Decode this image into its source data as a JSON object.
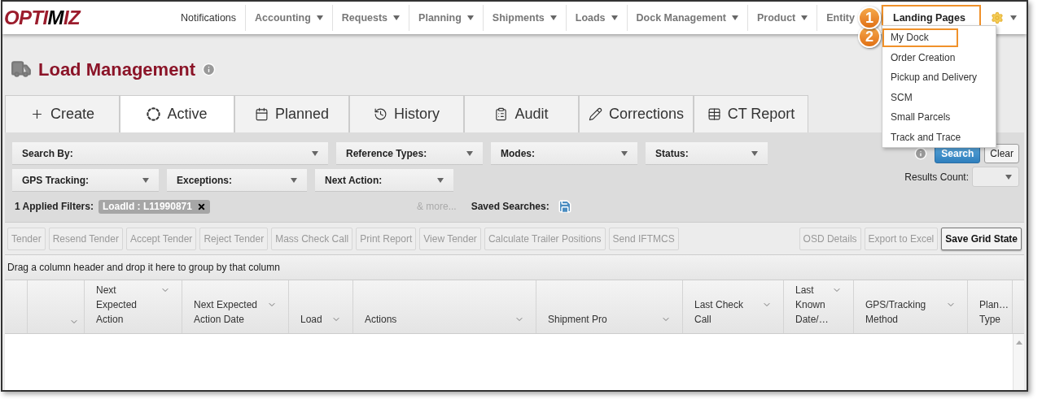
{
  "logo": {
    "parts": [
      "OPTI",
      "M",
      "IZ"
    ]
  },
  "nav": {
    "items": [
      {
        "label": "Notifications",
        "has_menu": false,
        "highlighted": false
      },
      {
        "label": "Accounting",
        "has_menu": true,
        "highlighted": false
      },
      {
        "label": "Requests",
        "has_menu": true,
        "highlighted": false
      },
      {
        "label": "Planning",
        "has_menu": true,
        "highlighted": false
      },
      {
        "label": "Shipments",
        "has_menu": true,
        "highlighted": false
      },
      {
        "label": "Loads",
        "has_menu": true,
        "highlighted": false
      },
      {
        "label": "Dock Management",
        "has_menu": true,
        "highlighted": false
      },
      {
        "label": "Product",
        "has_menu": true,
        "highlighted": false
      },
      {
        "label": "Entity",
        "has_menu": false,
        "highlighted": false
      },
      {
        "label": "Landing Pages",
        "has_menu": false,
        "highlighted": true
      }
    ]
  },
  "menu": {
    "items": [
      {
        "label": "My Dock",
        "highlighted": true
      },
      {
        "label": "Order Creation",
        "highlighted": false
      },
      {
        "label": "Pickup and Delivery",
        "highlighted": false
      },
      {
        "label": "SCM",
        "highlighted": false
      },
      {
        "label": "Small Parcels",
        "highlighted": false
      },
      {
        "label": "Track and Trace",
        "highlighted": false
      }
    ]
  },
  "callouts": [
    {
      "number": "1"
    },
    {
      "number": "2"
    }
  ],
  "page": {
    "title": "Load Management"
  },
  "tabs": [
    {
      "label": "Create",
      "kind": "create",
      "selected": false
    },
    {
      "label": "Active",
      "kind": "active",
      "selected": true
    },
    {
      "label": "Planned",
      "kind": "planned",
      "selected": false
    },
    {
      "label": "History",
      "kind": "history",
      "selected": false
    },
    {
      "label": "Audit",
      "kind": "audit",
      "selected": false
    },
    {
      "label": "Corrections",
      "kind": "corrections",
      "selected": false
    },
    {
      "label": "CT Report",
      "kind": "report",
      "selected": false
    }
  ],
  "filters": {
    "row_1": [
      "Search By:",
      "Reference Types:",
      "Modes:",
      "Status:"
    ],
    "row_2": [
      "GPS Tracking:",
      "Exceptions:",
      "Next Action:"
    ],
    "applied_label": "1 Applied Filters:",
    "chip": "LoadId : L11990871",
    "more": "& more...",
    "saved_searches": "Saved Searches:",
    "search": "Search",
    "clear": "Clear",
    "results_count": "Results Count:"
  },
  "toolbar": {
    "left": [
      {
        "label": "Tender",
        "disabled": true
      },
      {
        "label": "Resend Tender",
        "disabled": true
      },
      {
        "label": "Accept Tender",
        "disabled": true
      },
      {
        "label": "Reject Tender",
        "disabled": true
      },
      {
        "label": "Mass Check Call",
        "disabled": true
      },
      {
        "label": "Print Report",
        "disabled": true
      },
      {
        "label": "View Tender",
        "disabled": true
      },
      {
        "label": "Calculate Trailer Positions",
        "disabled": true
      },
      {
        "label": "Send IFTMCS",
        "disabled": true
      }
    ],
    "right": [
      {
        "label": "OSD Details",
        "disabled": true
      },
      {
        "label": "Export to Excel",
        "disabled": true
      },
      {
        "label": "Save Grid State",
        "disabled": false
      }
    ]
  },
  "group_bar": "Drag a column header and drop it here to group by that column",
  "table": {
    "columns": [
      {
        "menu": false
      },
      {
        "menu": true
      },
      {
        "label": "Next\nExpected\nAction",
        "menu": true
      },
      {
        "label": "Next Expected\nAction Date",
        "menu": true
      },
      {
        "label": "Load",
        "menu": true
      },
      {
        "label": "Actions",
        "menu": true
      },
      {
        "label": "Shipment Pro",
        "menu": true
      },
      {
        "label": "Last Check\nCall",
        "menu": true
      },
      {
        "label": "Last\nKnown\nDate/…",
        "menu": true
      },
      {
        "label": "GPS/Tracking\nMethod",
        "menu": true
      },
      {
        "label": "Plan…\nType",
        "menu": false
      }
    ]
  }
}
